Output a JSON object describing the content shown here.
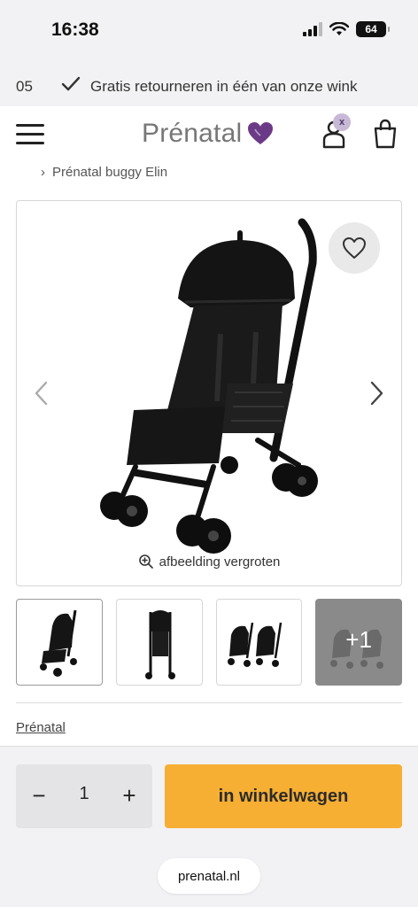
{
  "status": {
    "time": "16:38",
    "battery": "64"
  },
  "promo": {
    "prefix": "05",
    "text": "Gratis retourneren in één van onze wink"
  },
  "header": {
    "logo_text": "Prénatal",
    "account_badge": "x"
  },
  "breadcrumb": {
    "separator": "›",
    "current": "Prénatal buggy Elin"
  },
  "gallery": {
    "zoom_label": "afbeelding vergroten"
  },
  "thumbnails": {
    "more_label": "+1"
  },
  "brand": {
    "label": "Prénatal"
  },
  "purchase": {
    "qty_minus": "−",
    "qty_value": "1",
    "qty_plus": "+",
    "add_to_cart": "in winkelwagen"
  },
  "browser": {
    "url": "prenatal.nl"
  },
  "colors": {
    "accent": "#f6ae33",
    "logo_heart": "#6b3a86"
  }
}
